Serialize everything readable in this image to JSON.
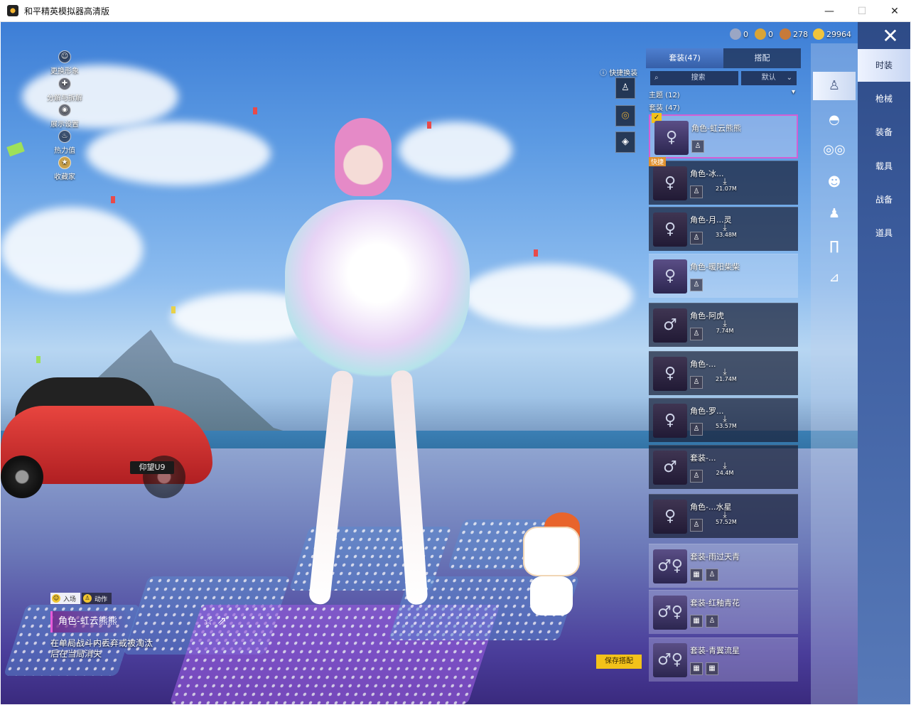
{
  "window": {
    "title": "和平精英模拟器高清版",
    "minimize": "—",
    "maximize": "☐",
    "close": "✕"
  },
  "currency": [
    {
      "icon": "silver-coin-icon",
      "value": "0",
      "color": "#9aa6c4"
    },
    {
      "icon": "gold-coin-icon",
      "value": "0",
      "color": "#d8a437"
    },
    {
      "icon": "bronze-coin-icon",
      "value": "278",
      "color": "#c77a3a"
    },
    {
      "icon": "diamond-coin-icon",
      "value": "29964",
      "color": "#f0c43c"
    }
  ],
  "left_menu": [
    {
      "label": "更换形象",
      "icon": "avatar-icon"
    },
    {
      "label": "分解与拆解",
      "icon": "dismantle-icon"
    },
    {
      "label": "展示设置",
      "icon": "eye-icon"
    },
    {
      "label": "热力值",
      "icon": "flame-icon"
    },
    {
      "label": "收藏家",
      "icon": "collector-badge-icon"
    }
  ],
  "quick_change": {
    "label": "快捷换装"
  },
  "panel": {
    "tabs": [
      "套装(47)",
      "搭配"
    ],
    "search_placeholder": "搜索",
    "sort": "默认",
    "theme_label": "主题 (12)",
    "outfit_label": "套装 (47)",
    "items": [
      {
        "name": "角色-虹云熊熊",
        "size": "",
        "selected": true
      },
      {
        "name": "角色-冰...",
        "size": "21.07M",
        "badge": "快捷"
      },
      {
        "name": "角色-月...灵",
        "size": "33.48M"
      },
      {
        "name": "角色-暖阳柴柴",
        "size": ""
      },
      {
        "name": "角色-阿虎",
        "size": "7.74M"
      },
      {
        "name": "角色-...",
        "size": "21.74M"
      },
      {
        "name": "角色-罗...",
        "size": "53.57M"
      },
      {
        "name": "套装-...",
        "size": "24.4M"
      },
      {
        "name": "角色-...水星",
        "size": "57.52M"
      },
      {
        "name": "套装-雨过天青",
        "size": ""
      },
      {
        "name": "套装-红釉青花",
        "size": ""
      },
      {
        "name": "套装-青翼流星",
        "size": ""
      }
    ]
  },
  "right_nav": [
    "时装",
    "枪械",
    "装备",
    "载具",
    "战备",
    "道具"
  ],
  "bottom": {
    "mode_tabs": [
      "入场",
      "动作"
    ],
    "outfit_name": "角色-虹云熊熊",
    "note": "在单局战斗内丢弃或被淘汰后在当局消失",
    "save_button": "保存搭配",
    "car_plate": "仰望U9"
  }
}
